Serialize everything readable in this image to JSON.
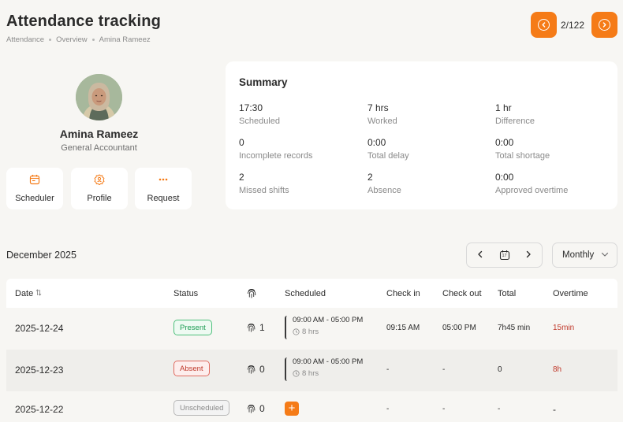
{
  "header": {
    "title": "Attendance tracking",
    "breadcrumb": [
      "Attendance",
      "Overview",
      "Amina Rameez"
    ],
    "pager": "2/122"
  },
  "profile": {
    "name": "Amina Rameez",
    "role": "General Accountant",
    "actions": [
      {
        "label": "Scheduler",
        "icon": "calendar-icon"
      },
      {
        "label": "Profile",
        "icon": "user-badge-icon"
      },
      {
        "label": "Request",
        "icon": "more-dots-icon"
      }
    ]
  },
  "summary": {
    "title": "Summary",
    "stats": [
      {
        "value": "17:30",
        "label": "Scheduled"
      },
      {
        "value": "7 hrs",
        "label": "Worked"
      },
      {
        "value": "1 hr",
        "label": "Difference"
      },
      {
        "value": "0",
        "label": "Incomplete records"
      },
      {
        "value": "0:00",
        "label": "Total delay"
      },
      {
        "value": "0:00",
        "label": "Total shortage"
      },
      {
        "value": "2",
        "label": "Missed shifts"
      },
      {
        "value": "2",
        "label": "Absence"
      },
      {
        "value": "0:00",
        "label": "Approved overtime"
      }
    ]
  },
  "period": {
    "month": "December 2025",
    "calendar_day": "17",
    "view": "Monthly"
  },
  "table": {
    "columns": [
      "Date",
      "Status",
      "Scheduled",
      "Check in",
      "Check out",
      "Total",
      "Overtime"
    ],
    "rows": [
      {
        "date": "2025-12-24",
        "status": "Present",
        "punches": "1",
        "scheduled": "09:00 AM - 05:00 PM",
        "hours": "8 hrs",
        "check_in": "09:15 AM",
        "check_out": "05:00 PM",
        "total": "7h45 min",
        "overtime": "15min"
      },
      {
        "date": "2025-12-23",
        "status": "Absent",
        "punches": "0",
        "scheduled": "09:00 AM - 05:00 PM",
        "hours": "8 hrs",
        "check_in": "-",
        "check_out": "-",
        "total": "0",
        "overtime": "8h"
      },
      {
        "date": "2025-12-22",
        "status": "Unscheduled",
        "punches": "0",
        "scheduled": "",
        "hours": "",
        "check_in": "-",
        "check_out": "-",
        "total": "-",
        "overtime": "-"
      }
    ]
  },
  "colors": {
    "accent": "#f57b17",
    "present": "#1f9d55",
    "absent": "#c0392b"
  }
}
